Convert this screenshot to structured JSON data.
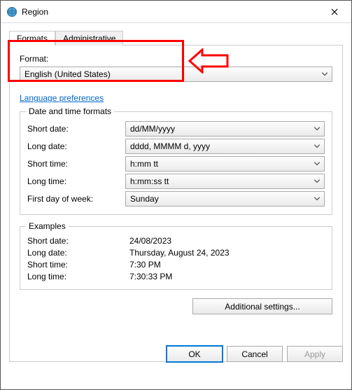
{
  "window": {
    "title": "Region"
  },
  "tabs": {
    "formats": "Formats",
    "administrative": "Administrative"
  },
  "format": {
    "label": "Format:",
    "value": "English (United States)"
  },
  "link": {
    "preferences": "Language preferences"
  },
  "dt": {
    "legend": "Date and time formats",
    "short_date": {
      "label": "Short date:",
      "value": "dd/MM/yyyy"
    },
    "long_date": {
      "label": "Long date:",
      "value": "dddd, MMMM d, yyyy"
    },
    "short_time": {
      "label": "Short time:",
      "value": "h:mm tt"
    },
    "long_time": {
      "label": "Long time:",
      "value": "h:mm:ss tt"
    },
    "first_day": {
      "label": "First day of week:",
      "value": "Sunday"
    }
  },
  "examples": {
    "legend": "Examples",
    "short_date": {
      "label": "Short date:",
      "value": "24/08/2023"
    },
    "long_date": {
      "label": "Long date:",
      "value": "Thursday, August 24, 2023"
    },
    "short_time": {
      "label": "Short time:",
      "value": "7:30 PM"
    },
    "long_time": {
      "label": "Long time:",
      "value": "7:30:33 PM"
    }
  },
  "buttons": {
    "additional": "Additional settings...",
    "ok": "OK",
    "cancel": "Cancel",
    "apply": "Apply"
  },
  "annotation": {
    "highlight_color": "#f00"
  }
}
